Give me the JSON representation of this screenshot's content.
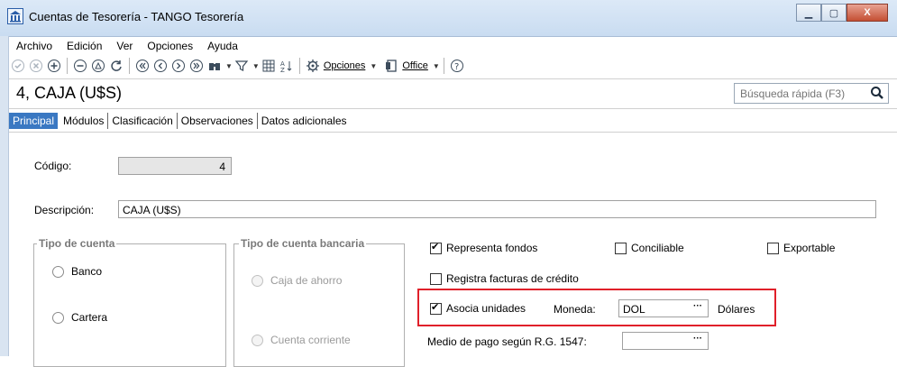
{
  "window": {
    "title": "Cuentas de Tesorería - TANGO Tesorería"
  },
  "menu": [
    {
      "label": "Archivo"
    },
    {
      "label": "Edición"
    },
    {
      "label": "Ver"
    },
    {
      "label": "Opciones"
    },
    {
      "label": "Ayuda"
    }
  ],
  "toolbar": {
    "opciones_label": "Opciones",
    "office_label": "Office"
  },
  "record": {
    "title": "4, CAJA  (U$S)"
  },
  "search": {
    "placeholder": "Búsqueda rápida (F3)"
  },
  "tabs": [
    {
      "label": "Principal",
      "active": true
    },
    {
      "label": "Módulos"
    },
    {
      "label": "Clasificación"
    },
    {
      "label": "Observaciones"
    },
    {
      "label": "Datos adicionales"
    }
  ],
  "form": {
    "codigo_label": "Código:",
    "codigo_value": "4",
    "descripcion_label": "Descripción:",
    "descripcion_value": "CAJA  (U$S)",
    "tipo_cuenta": {
      "title": "Tipo de cuenta",
      "options": [
        "Banco",
        "Cartera"
      ]
    },
    "tipo_cuenta_bancaria": {
      "title": "Tipo de cuenta bancaria",
      "options": [
        "Caja de ahorro",
        "Cuenta corriente"
      ]
    },
    "representa_fondos": {
      "label": "Representa fondos",
      "checked": true
    },
    "conciliable": {
      "label": "Conciliable",
      "checked": false
    },
    "exportable": {
      "label": "Exportable",
      "checked": false
    },
    "registra_facturas": {
      "label": "Registra facturas de crédito",
      "checked": false
    },
    "asocia_unidades": {
      "label": "Asocia unidades",
      "checked": true
    },
    "moneda_label": "Moneda:",
    "moneda_value": "DOL",
    "moneda_desc": "Dólares",
    "medio_pago_label": "Medio de pago según R.G. 1547:",
    "medio_pago_value": ""
  }
}
